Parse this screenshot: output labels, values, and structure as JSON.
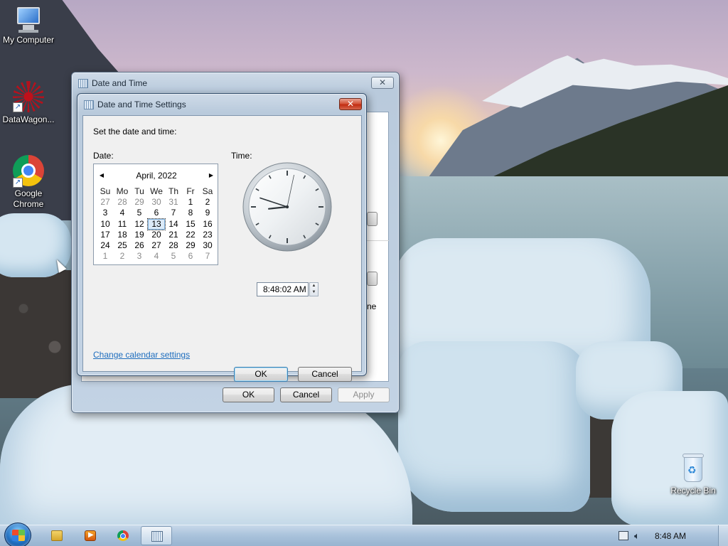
{
  "desktop": {
    "icons": [
      {
        "label": "My Computer",
        "icon": "computer-icon"
      },
      {
        "label": "DataWagon...",
        "icon": "datawagon-icon"
      },
      {
        "label": "Google Chrome",
        "icon": "chrome-icon"
      },
      {
        "label": "Recycle Bin",
        "icon": "recycle-bin-icon"
      }
    ]
  },
  "outer_window": {
    "title": "Date and Time",
    "close_glyph": "✕",
    "ok_label": "OK",
    "cancel_label": "Cancel",
    "apply_label": "Apply",
    "partial_text": "ne"
  },
  "settings_dialog": {
    "title": "Date and Time Settings",
    "close_glyph": "✕",
    "instruction": "Set the date and time:",
    "date_label": "Date:",
    "time_label": "Time:",
    "calendar": {
      "month_year": "April, 2022",
      "prev_glyph": "◀",
      "next_glyph": "▶",
      "weekdays": [
        "Su",
        "Mo",
        "Tu",
        "We",
        "Th",
        "Fr",
        "Sa"
      ],
      "weeks": [
        [
          "27",
          "28",
          "29",
          "30",
          "31",
          "1",
          "2"
        ],
        [
          "3",
          "4",
          "5",
          "6",
          "7",
          "8",
          "9"
        ],
        [
          "10",
          "11",
          "12",
          "13",
          "14",
          "15",
          "16"
        ],
        [
          "17",
          "18",
          "19",
          "20",
          "21",
          "22",
          "23"
        ],
        [
          "24",
          "25",
          "26",
          "27",
          "28",
          "29",
          "30"
        ],
        [
          "1",
          "2",
          "3",
          "4",
          "5",
          "6",
          "7"
        ]
      ],
      "selected_day": "13"
    },
    "clock": {
      "hour": 8,
      "minute": 48,
      "second": 2
    },
    "time_value": "8:48:02 AM",
    "change_calendar_link": "Change calendar settings",
    "ok_label": "OK",
    "cancel_label": "Cancel"
  },
  "taskbar": {
    "pinned": [
      {
        "name": "windows-explorer",
        "icon": "folder-icon"
      },
      {
        "name": "media-player",
        "icon": "media-player-icon"
      },
      {
        "name": "google-chrome",
        "icon": "chrome-icon"
      },
      {
        "name": "date-and-time",
        "icon": "date-time-icon",
        "active": true
      }
    ],
    "clock": "8:48 AM"
  }
}
